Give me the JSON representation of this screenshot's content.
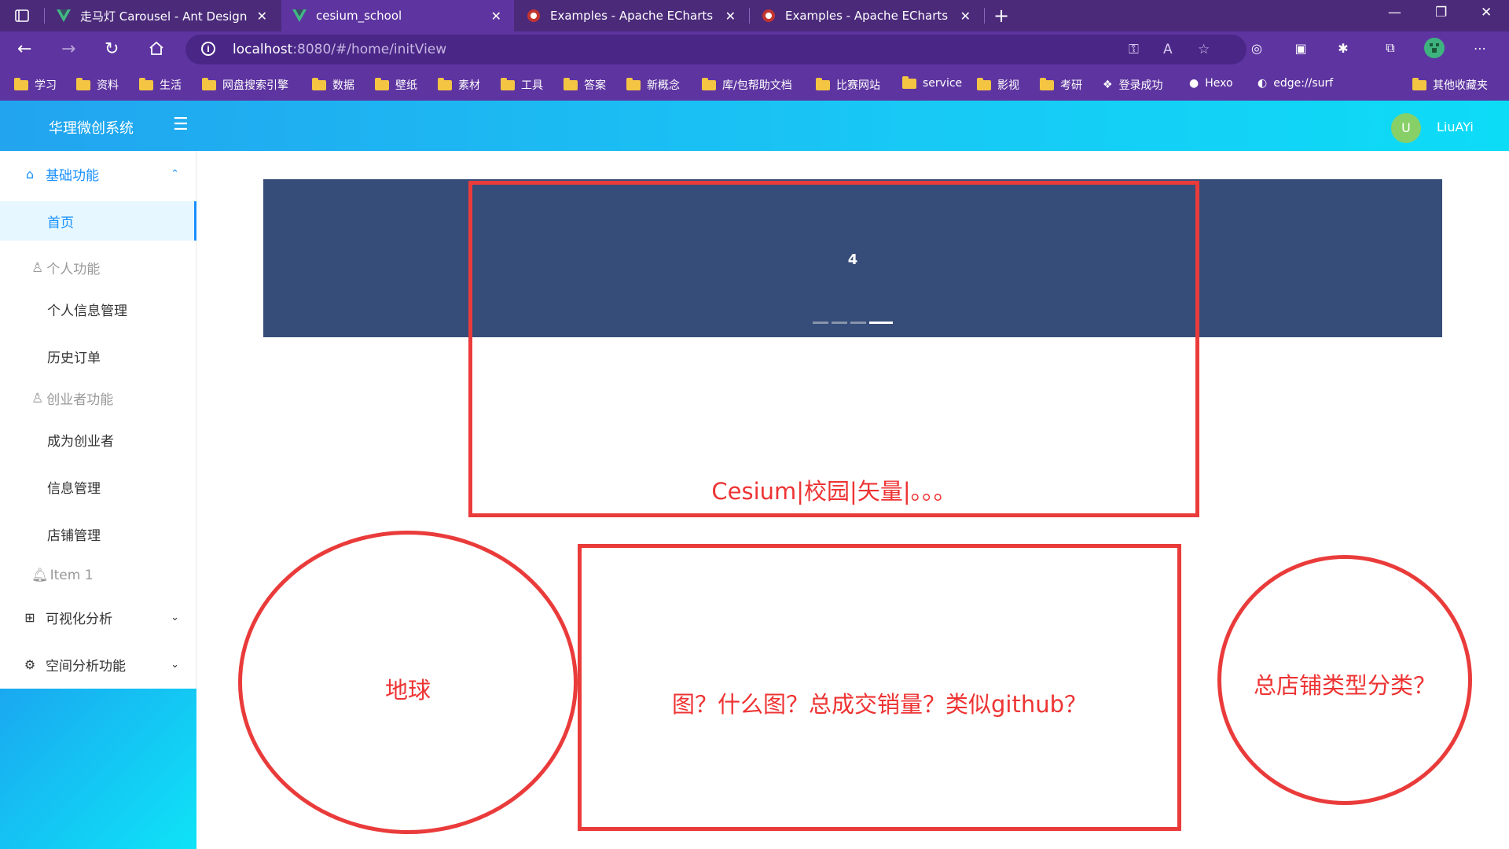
{
  "browser": {
    "tabs": [
      {
        "title": "走马灯 Carousel - Ant Design Vu",
        "favicon": "vue-icon"
      },
      {
        "title": "cesium_school",
        "favicon": "vue-icon",
        "active": true
      },
      {
        "title": "Examples - Apache ECharts",
        "favicon": "echarts-icon"
      },
      {
        "title": "Examples - Apache ECharts",
        "favicon": "echarts-icon"
      }
    ],
    "url_host": "localhost",
    "url_rest": ":8080/#/home/initView",
    "bookmarks": [
      "学习",
      "资料",
      "生活",
      "网盘搜索引擎",
      "数据",
      "壁纸",
      "素材",
      "工具",
      "答案",
      "新概念",
      "库/包帮助文档",
      "比赛网站",
      "service",
      "影视",
      "考研",
      "登录成功",
      "Hexo",
      "edge://surf"
    ],
    "other_bookmarks": "其他收藏夹"
  },
  "header": {
    "brand": "华理微创系统",
    "avatar_letter": "U",
    "username": "LiuAYi"
  },
  "sidebar": {
    "basic": "基础功能",
    "home": "首页",
    "personal_group": "个人功能",
    "personal_info": "个人信息管理",
    "order_history": "历史订单",
    "founder_group": "创业者功能",
    "become_founder": "成为创业者",
    "info_mgmt": "信息管理",
    "shop_mgmt": "店铺管理",
    "item1": "Item 1",
    "visual": "可视化分析",
    "spatial": "空间分析功能"
  },
  "carousel": {
    "current_slide": "4",
    "slide_count": 4,
    "active_index": 3
  },
  "annotations": {
    "top": "Cesium|校园|矢量|。。。",
    "globe": "地球",
    "chart": "图？什么图？总成交销量？类似github？",
    "category": "总店铺类型分类？"
  },
  "colors": {
    "annotation": "#ea3b3b",
    "carousel_bg": "#364d79",
    "primary": "#1890ff"
  }
}
